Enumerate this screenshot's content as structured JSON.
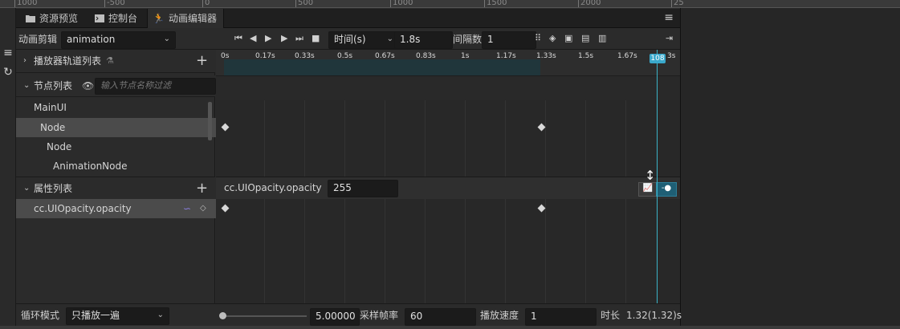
{
  "ruler": {
    "ticks": [
      "1000",
      "-500",
      "0",
      "500",
      "1000",
      "1500",
      "2000",
      "25"
    ]
  },
  "tabs": [
    {
      "label": "资源预览",
      "icon": "folder-icon"
    },
    {
      "label": "控制台",
      "icon": "terminal-icon"
    },
    {
      "label": "动画编辑器",
      "icon": "running-figure-icon"
    }
  ],
  "toolbar": {
    "clip_label": "动画剪辑",
    "clip_value": "animation",
    "time_mode": "时间(s)",
    "time_value": "1.8s",
    "interval_label": "间隔数",
    "interval_value": "1"
  },
  "left": {
    "player_tracks": "播放器轨道列表",
    "node_list": "节点列表",
    "filter_placeholder": "输入节点名称过滤",
    "nodes": [
      "MainUI",
      "Node",
      "Node",
      "AnimationNode"
    ],
    "property_list": "属性列表",
    "property": "cc.UIOpacity.opacity"
  },
  "timeline": {
    "ticks": [
      "0s",
      "0.17s",
      "0.33s",
      "0.5s",
      "0.67s",
      "0.83s",
      "1s",
      "1.17s",
      "1.33s",
      "1.5s",
      "1.67s",
      "108",
      "3s"
    ],
    "property_name": "cc.UIOpacity.opacity",
    "property_value": "255",
    "cursor_label": "108"
  },
  "bottom": {
    "loop_label": "循环模式",
    "loop_value": "只播放一遍",
    "zoom_value": "5.00000",
    "sample_label": "采样帧率",
    "sample_value": "60",
    "speed_label": "播放速度",
    "speed_value": "1",
    "duration_label": "时长",
    "duration_value": "1.32(1.32)s"
  },
  "colors": {
    "accent": "#3aa9cc",
    "cursor": "#3bb3c7"
  }
}
